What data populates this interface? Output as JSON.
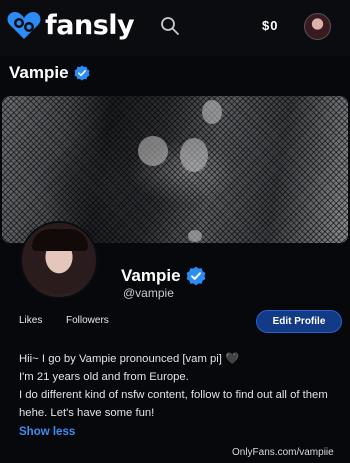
{
  "header": {
    "brand": "fansly",
    "wallet": "$0",
    "logo_color": "#2a8cf4"
  },
  "account": {
    "name": "Vampie",
    "verified": true
  },
  "profile": {
    "display_name": "Vampie",
    "handle": "@vampie",
    "stats": {
      "likes_label": "Likes",
      "followers_label": "Followers"
    },
    "edit_button": "Edit Profile",
    "bio": [
      "Hii~ I go by Vampie pronounced [vam pi] 🖤",
      "I'm 21 years old and from Europe.",
      "I do different kind of nsfw content, follow to find out all of them",
      "hehe. Let's have some fun!"
    ],
    "show_less": "Show less"
  },
  "watermark": "OnlyFans.com/vampiie",
  "colors": {
    "accent": "#2a8cf4",
    "button_bg": "#123a86",
    "link": "#3e8cf2",
    "background": "#07080b"
  }
}
